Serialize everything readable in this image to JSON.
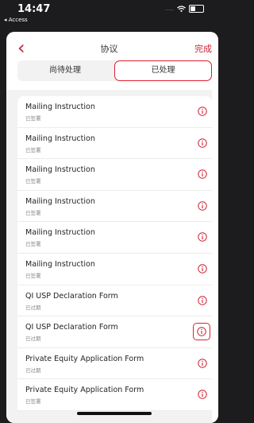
{
  "status_bar": {
    "time": "14:47",
    "back_app": "◂ Access",
    "signal_dots": "....."
  },
  "nav": {
    "back": "‹",
    "title": "协议",
    "done": "完成"
  },
  "tabs": [
    {
      "label": "尚待处理",
      "selected": false
    },
    {
      "label": "已处理",
      "selected": true
    }
  ],
  "items": [
    {
      "title": "Mailing Instruction",
      "status": "已签署"
    },
    {
      "title": "Mailing Instruction",
      "status": "已签署"
    },
    {
      "title": "Mailing Instruction",
      "status": "已签署"
    },
    {
      "title": "Mailing Instruction",
      "status": "已签署"
    },
    {
      "title": "Mailing Instruction",
      "status": "已签署"
    },
    {
      "title": "Mailing Instruction",
      "status": "已签署"
    },
    {
      "title": "QI USP Declaration Form",
      "status": "已过期"
    },
    {
      "title": "QI USP Declaration Form",
      "status": "已过期",
      "highlighted": true
    },
    {
      "title": "Private Equity Application Form",
      "status": "已过期"
    },
    {
      "title": "Private Equity Application Form",
      "status": "已签署"
    }
  ],
  "colors": {
    "accent": "#cc2030",
    "highlight": "#e01e2d"
  },
  "icons": {
    "row_action": "info-icon"
  }
}
